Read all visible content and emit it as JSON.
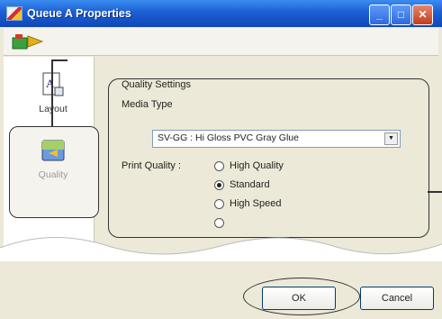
{
  "window": {
    "title": "Queue A Properties"
  },
  "titlebar_buttons": {
    "minimize": "_",
    "maximize": "□",
    "close": "✕"
  },
  "sidebar": {
    "items": [
      {
        "label": "Layout",
        "icon": "layout-page-icon"
      },
      {
        "label": "Quality",
        "icon": "quality-icon"
      }
    ]
  },
  "quality_settings": {
    "group_title": "Quality Settings",
    "media_type_label": "Media Type",
    "media_type_value": "SV-GG : Hi Gloss PVC Gray Glue",
    "print_quality_label": "Print Quality :",
    "options": [
      "High Quality",
      "Standard",
      "High Speed",
      ""
    ],
    "selected": "Standard"
  },
  "buttons": {
    "ok": "OK",
    "cancel": "Cancel"
  },
  "colors": {
    "titlebar": "#1c5fd4",
    "background": "#ece9d8"
  }
}
